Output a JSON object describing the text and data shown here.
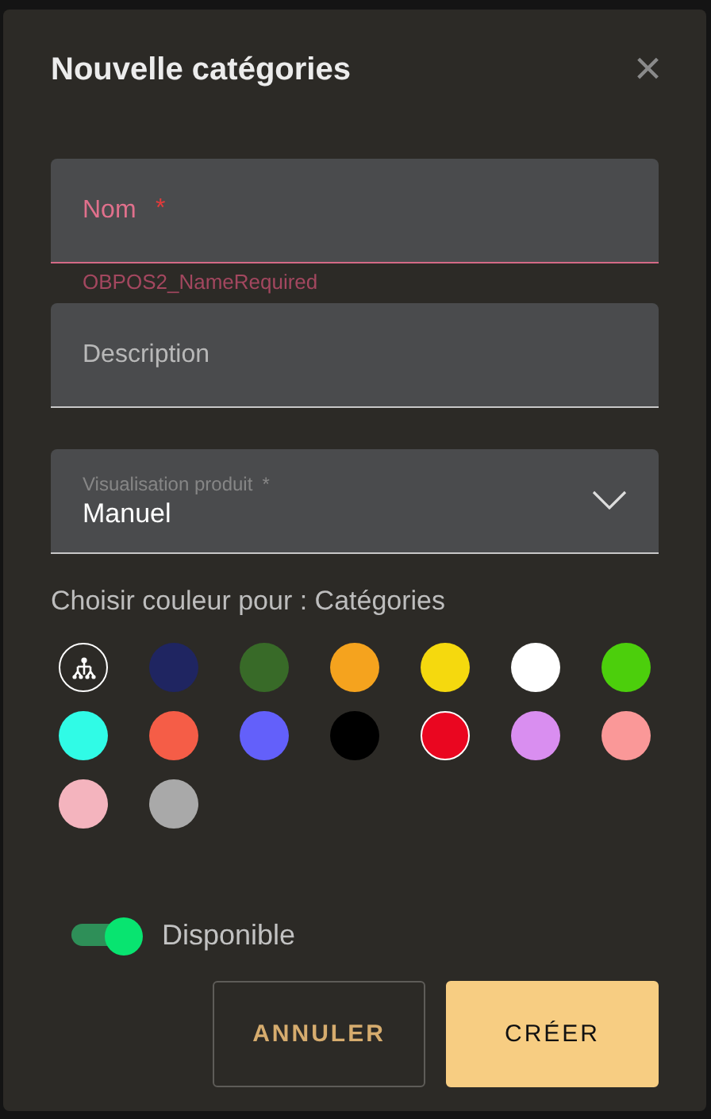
{
  "dialog": {
    "title": "Nouvelle catégories",
    "close_label": "×"
  },
  "fields": [
    {
      "kind": "text",
      "placeholder": "Nom",
      "required_mark": "*",
      "error": "OBPOS2_NameRequired"
    },
    {
      "kind": "text",
      "placeholder": "Description"
    },
    {
      "kind": "select",
      "label": "Visualisation produit",
      "required_mark": "*",
      "value": "Manuel"
    }
  ],
  "color_heading": "Choisir couleur pour : Catégories",
  "swatches": [
    {
      "kind": "default",
      "selected": false
    },
    {
      "kind": "color",
      "color": "#1f2561",
      "selected": false
    },
    {
      "kind": "color",
      "color": "#386a28",
      "selected": false
    },
    {
      "kind": "color",
      "color": "#f5a31e",
      "selected": false
    },
    {
      "kind": "color",
      "color": "#f5d90e",
      "selected": false
    },
    {
      "kind": "color",
      "color": "#ffffff",
      "selected": false
    },
    {
      "kind": "color",
      "color": "#4ccf0c",
      "selected": false
    },
    {
      "kind": "color",
      "color": "#30fbe6",
      "selected": false
    },
    {
      "kind": "color",
      "color": "#f55d47",
      "selected": false
    },
    {
      "kind": "color",
      "color": "#6360fa",
      "selected": false
    },
    {
      "kind": "color",
      "color": "#000000",
      "selected": false
    },
    {
      "kind": "color",
      "color": "#ea0620",
      "selected": true
    },
    {
      "kind": "color",
      "color": "#d98ef0",
      "selected": false
    },
    {
      "kind": "color",
      "color": "#fa9898",
      "selected": false
    },
    {
      "kind": "color",
      "color": "#f4b4be",
      "selected": false
    },
    {
      "kind": "color",
      "color": "#a9a9a9",
      "selected": false
    }
  ],
  "available": {
    "label": "Disponible",
    "on": true
  },
  "buttons": [
    {
      "kind": "secondary",
      "label": "ANNULER"
    },
    {
      "kind": "primary",
      "label": "CRÉER"
    }
  ]
}
